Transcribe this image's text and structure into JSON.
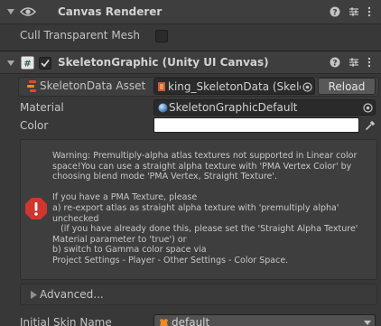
{
  "canvas_renderer": {
    "title": "Canvas Renderer",
    "cull_label": "Cull Transparent Mesh",
    "cull_checked": false
  },
  "skeleton_graphic": {
    "title": "SkeletonGraphic (Unity UI Canvas)",
    "enabled": true,
    "skeleton_data_label": "SkeletonData Asset",
    "skeleton_data_value": "king_SkeletonData (Skelet",
    "reload_label": "Reload",
    "material_label": "Material",
    "material_value": "SkeletonGraphicDefault",
    "color_label": "Color",
    "color_value": "#ffffff",
    "warning_text": "Warning: Premultiply-alpha atlas textures not supported in Linear color space!You can use a straight alpha texture with 'PMA Vertex Color' by choosing blend mode 'PMA Vertex, Straight Texture'.\n\nIf you have a PMA Texture, please\na) re-export atlas as straight alpha texture with 'premultiply alpha' unchecked\n   (if you have already done this, please set the 'Straight Alpha Texture' Material parameter to 'true') or\nb) switch to Gamma color space via\nProject Settings - Player - Other Settings - Color Space.",
    "advanced_label": "Advanced...",
    "initial_skin_label": "Initial Skin Name",
    "initial_skin_value": "default"
  },
  "colors": {
    "accent_check": "#d9d9d9",
    "error_red": "#d0362f",
    "spine_red": "#e0482e",
    "spine_orange": "#f08a24"
  },
  "icons": [
    "eye-icon",
    "help-icon",
    "preset-icon",
    "kebab-menu-icon",
    "collapse-arrow-icon",
    "script-icon",
    "checkbox-icon",
    "spine-asset-icon",
    "object-picker-icon",
    "material-sphere-icon",
    "eyedropper-icon",
    "error-icon",
    "foldout-arrow-icon",
    "skin-icon"
  ]
}
